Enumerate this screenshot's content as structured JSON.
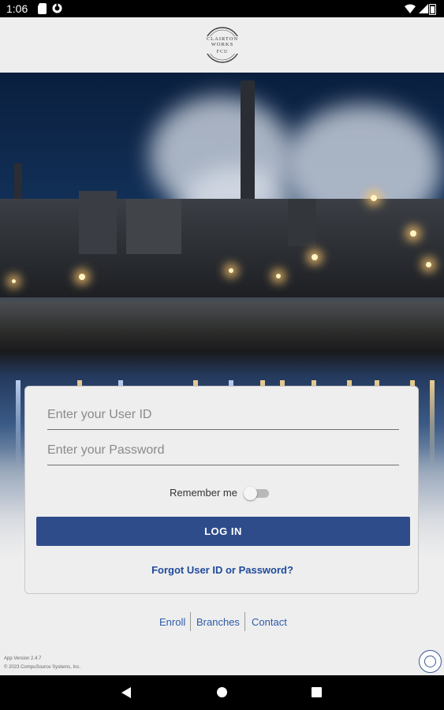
{
  "status_bar": {
    "time": "1:06",
    "icons": [
      "sd-card-icon",
      "sync-icon",
      "wifi-icon",
      "signal-icon",
      "battery-icon"
    ]
  },
  "header": {
    "logo_name": "CLAIRTON WORKS",
    "logo_sub": "FCU"
  },
  "login": {
    "user_id_placeholder": "Enter your User ID",
    "password_placeholder": "Enter your Password",
    "remember_label": "Remember me",
    "remember_enabled": false,
    "login_label": "LOG IN",
    "forgot_label": "Forgot User ID or Password?"
  },
  "links": {
    "enroll": "Enroll",
    "branches": "Branches",
    "contact": "Contact"
  },
  "footer": {
    "version": "App Version 2.4.7",
    "copyright": "© 2023 CompuSource Systems, Inc."
  },
  "colors": {
    "primary_button": "#2f4c8a",
    "link": "#2e5aa8",
    "background": "#eeeeee"
  }
}
